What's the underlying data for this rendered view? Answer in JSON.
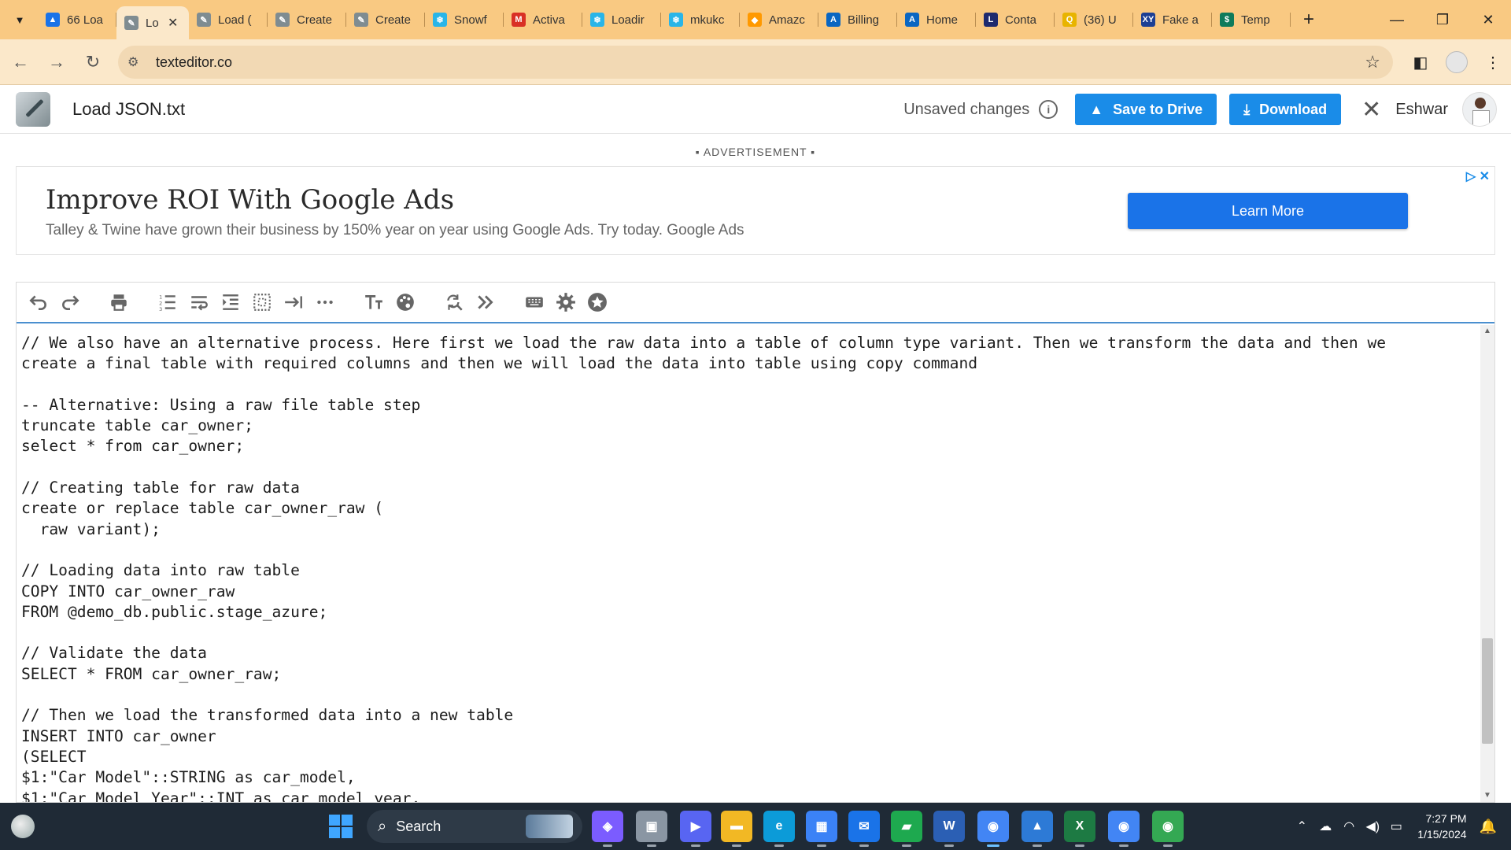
{
  "browser": {
    "tabs": [
      {
        "title": "66 Loa",
        "icon": "drive-icon",
        "color": "#1a73e8",
        "glyph": "▲"
      },
      {
        "title": "Lo",
        "icon": "texteditor-icon",
        "color": "#7f8c91",
        "glyph": "✎",
        "active": true
      },
      {
        "title": "Load (",
        "icon": "texteditor-icon",
        "color": "#7f8c91",
        "glyph": "✎"
      },
      {
        "title": "Create",
        "icon": "texteditor-icon",
        "color": "#7f8c91",
        "glyph": "✎"
      },
      {
        "title": "Create",
        "icon": "texteditor-icon",
        "color": "#7f8c91",
        "glyph": "✎"
      },
      {
        "title": "Snowf",
        "icon": "snowflake-icon",
        "color": "#29b5e8",
        "glyph": "❄"
      },
      {
        "title": "Activa",
        "icon": "gmail-icon",
        "color": "#d93025",
        "glyph": "M"
      },
      {
        "title": "Loadir",
        "icon": "snowflake-icon",
        "color": "#29b5e8",
        "glyph": "❄"
      },
      {
        "title": "mkukc",
        "icon": "snowflake-icon",
        "color": "#29b5e8",
        "glyph": "❄"
      },
      {
        "title": "Amazc",
        "icon": "aws-icon",
        "color": "#ff9900",
        "glyph": "◆"
      },
      {
        "title": "Billing",
        "icon": "azure-icon",
        "color": "#0a66c2",
        "glyph": "A"
      },
      {
        "title": "Home",
        "icon": "azure-icon",
        "color": "#0a66c2",
        "glyph": "A"
      },
      {
        "title": "Conta",
        "icon": "contact-icon",
        "color": "#1e2a6e",
        "glyph": "L"
      },
      {
        "title": "(36) U",
        "icon": "chat-icon",
        "color": "#e8b400",
        "glyph": "Q"
      },
      {
        "title": "Fake a",
        "icon": "xy-icon",
        "color": "#1c3f94",
        "glyph": "XY"
      },
      {
        "title": "Temp",
        "icon": "temp-icon",
        "color": "#0f7b5b",
        "glyph": "$"
      }
    ],
    "new_tab": "+",
    "url": "texteditor.co"
  },
  "app": {
    "doc_title": "Load JSON.txt",
    "status": "Unsaved changes",
    "save_label": "Save to Drive",
    "download_label": "Download",
    "user_name": "Eshwar"
  },
  "ad": {
    "label": "▪ ADVERTISEMENT ▪",
    "headline": "Improve ROI With Google Ads",
    "body": "Talley & Twine have grown their business by 150% year on year using Google Ads. Try today. Google Ads",
    "cta": "Learn More"
  },
  "editor": {
    "toolbar": [
      "undo-icon",
      "redo-icon",
      "print-icon",
      "line-numbers-icon",
      "word-wrap-icon",
      "indent-icon",
      "select-all-icon",
      "tab-icon",
      "more-icon",
      "font-size-icon",
      "theme-icon",
      "find-replace-icon",
      "fast-forward-icon",
      "keyboard-icon",
      "settings-icon",
      "star-icon"
    ],
    "lines": [
      "// We also have an alternative process. Here first we load the raw data into a table of column type variant. Then we transform the data and then we",
      "create a final table with required columns and then we will load the data into table using copy command",
      "",
      "-- Alternative: Using a raw file table step",
      "truncate table car_owner;",
      "select * from car_owner;",
      "",
      "// Creating table for raw data",
      "create or replace table car_owner_raw (",
      "  raw variant);",
      "",
      "// Loading data into raw table",
      "COPY INTO car_owner_raw",
      "FROM @demo_db.public.stage_azure;",
      "",
      "// Validate the data",
      "SELECT * FROM car_owner_raw;",
      "",
      "// Then we load the transformed data into a new table",
      "INSERT INTO car_owner",
      "(SELECT",
      "$1:\"Car Model\"::STRING as car_model,",
      "$1:\"Car Model Year\"::INT as car_model_year,"
    ]
  },
  "taskbar": {
    "search": "Search",
    "time": "7:27 PM",
    "date": "1/15/2024",
    "apps": [
      {
        "name": "copilot-icon",
        "color": "#7b5cff",
        "glyph": "◈"
      },
      {
        "name": "task-view-icon",
        "color": "#8a96a3",
        "glyph": "▣"
      },
      {
        "name": "meet-icon",
        "color": "#5865f2",
        "glyph": "▶"
      },
      {
        "name": "file-explorer-icon",
        "color": "#f2b824",
        "glyph": "▬"
      },
      {
        "name": "edge-icon",
        "color": "#0c9bd8",
        "glyph": "e"
      },
      {
        "name": "store-icon",
        "color": "#3b82f6",
        "glyph": "▦"
      },
      {
        "name": "mail-icon",
        "color": "#1a73e8",
        "glyph": "✉"
      },
      {
        "name": "chat-app-icon",
        "color": "#1ea94f",
        "glyph": "▰"
      },
      {
        "name": "word-icon",
        "color": "#2b5fb4",
        "glyph": "W"
      },
      {
        "name": "chrome-icon",
        "color": "#4285f4",
        "glyph": "◉",
        "active": true
      },
      {
        "name": "paint-icon",
        "color": "#2d7ad6",
        "glyph": "▲"
      },
      {
        "name": "excel-icon",
        "color": "#1d7a43",
        "glyph": "X"
      },
      {
        "name": "chrome-profile-icon",
        "color": "#4285f4",
        "glyph": "◉"
      },
      {
        "name": "chrome-profile-2-icon",
        "color": "#34a853",
        "glyph": "◉"
      }
    ]
  }
}
